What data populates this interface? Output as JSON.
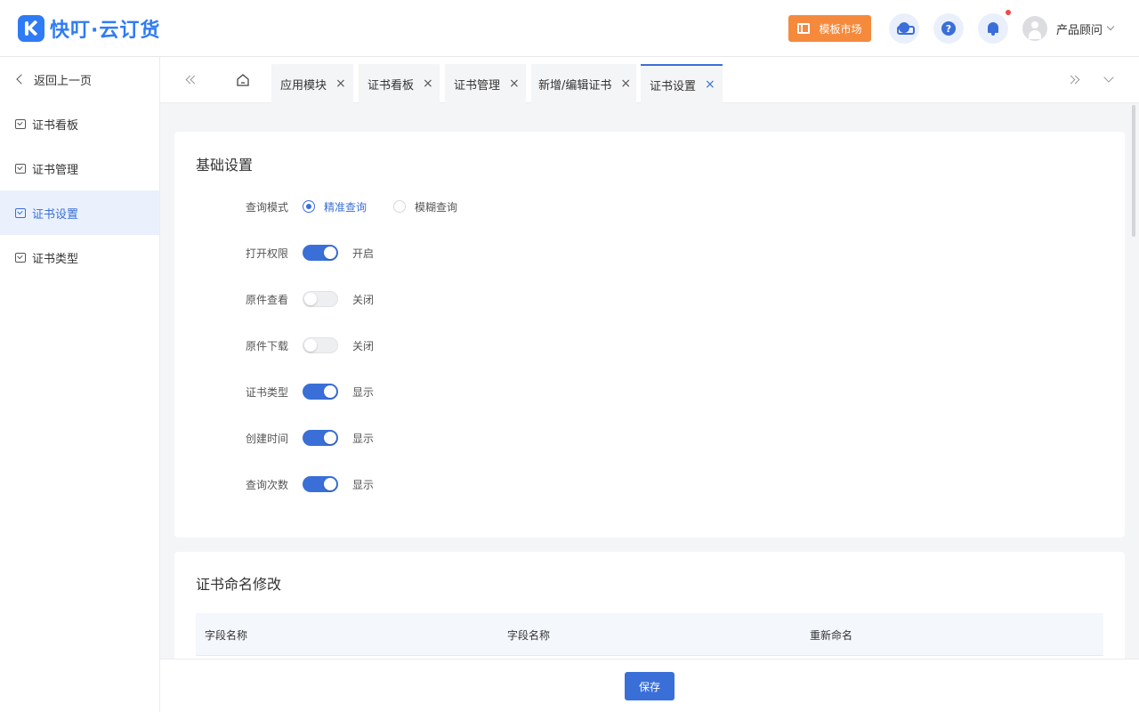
{
  "app": {
    "logo_text": "快叮·云订货"
  },
  "header": {
    "market_label": "模板市场",
    "user_name": "产品顾问"
  },
  "sidebar": {
    "back_label": "返回上一页",
    "items": [
      {
        "label": "证书看板"
      },
      {
        "label": "证书管理"
      },
      {
        "label": "证书设置",
        "active": true
      },
      {
        "label": "证书类型"
      }
    ]
  },
  "tabs": [
    {
      "label": "应用模块"
    },
    {
      "label": "证书看板"
    },
    {
      "label": "证书管理"
    },
    {
      "label": "新增/编辑证书"
    },
    {
      "label": "证书设置",
      "active": true
    }
  ],
  "basic": {
    "title": "基础设置",
    "query_mode": {
      "label": "查询模式",
      "options": [
        "精准查询",
        "模糊查询"
      ],
      "selected": "精准查询"
    },
    "switches": [
      {
        "label": "打开权限",
        "state": true,
        "text": "开启"
      },
      {
        "label": "原件查看",
        "state": false,
        "text": "关闭"
      },
      {
        "label": "原件下载",
        "state": false,
        "text": "关闭"
      },
      {
        "label": "证书类型",
        "state": true,
        "text": "显示"
      },
      {
        "label": "创建时间",
        "state": true,
        "text": "显示"
      },
      {
        "label": "查询次数",
        "state": true,
        "text": "显示"
      }
    ]
  },
  "rename": {
    "title": "证书命名修改",
    "columns": [
      "字段名称",
      "字段名称",
      "重新命名"
    ]
  },
  "footer": {
    "save_label": "保存"
  },
  "colors": {
    "primary": "#3a6fd8",
    "market": "#f58a3d",
    "notify": "#f04848"
  }
}
